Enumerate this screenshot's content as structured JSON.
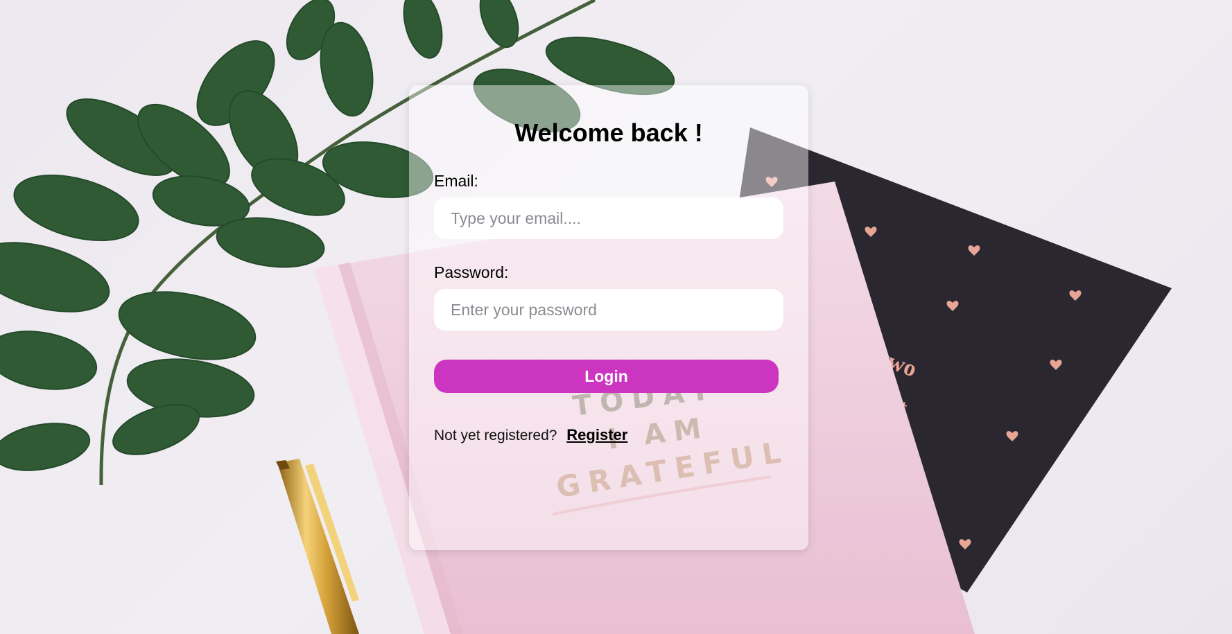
{
  "login": {
    "title": "Welcome back !",
    "email_label": "Email:",
    "email_placeholder": "Type your email....",
    "email_value": "",
    "password_label": "Password:",
    "password_placeholder": "Enter your password",
    "password_value": "",
    "login_button": "Login",
    "register_prompt": "Not yet registered?",
    "register_link": "Register"
  },
  "background": {
    "book_text_lines": [
      "TODAY",
      "I AM",
      "GRATEFUL"
    ],
    "notebook_text_lines": [
      "wo",
      "nt"
    ],
    "colors": {
      "accent": "#cc35c0",
      "leaf": "#2f5a34",
      "pink_book": "#efd0de",
      "dark_notebook": "#2a2730",
      "gold_pen": "#c9992f"
    }
  }
}
